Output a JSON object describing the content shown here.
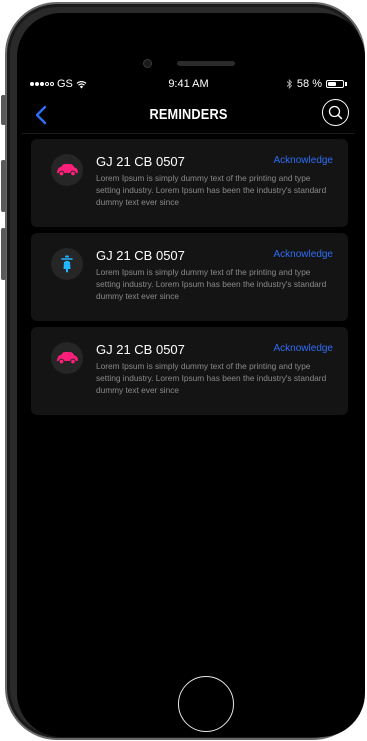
{
  "status_bar": {
    "carrier": "GS",
    "time": "9:41 AM",
    "bluetooth": "bluetooth-icon",
    "battery_percent": "58 %",
    "battery_level": 0.58
  },
  "nav": {
    "title": "REMINDERS",
    "back_icon": "chevron-left-icon",
    "search_icon": "search-icon"
  },
  "reminders": [
    {
      "vehicle_icon": "car-icon",
      "icon_color": "#ff1f7a",
      "plate": "GJ 21 CB 0507",
      "action": "Acknowledge",
      "description": "Lorem Ipsum is simply dummy text of the printing and type setting industry. Lorem Ipsum has been the industry's standard dummy text ever since"
    },
    {
      "vehicle_icon": "scooter-icon",
      "icon_color": "#1fb6ff",
      "plate": "GJ 21 CB 0507",
      "action": "Acknowledge",
      "description": "Lorem Ipsum is simply dummy text of the printing and type setting industry. Lorem Ipsum has been the industry's standard dummy text ever since"
    },
    {
      "vehicle_icon": "car-icon",
      "icon_color": "#ff1f7a",
      "plate": "GJ 21 CB 0507",
      "action": "Acknowledge",
      "description": "Lorem Ipsum is simply dummy text of the printing and type setting industry. Lorem Ipsum has been the industry's standard dummy text ever since"
    }
  ],
  "colors": {
    "accent": "#2f6df5",
    "card_bg": "#141414",
    "screen_bg": "#000000"
  }
}
